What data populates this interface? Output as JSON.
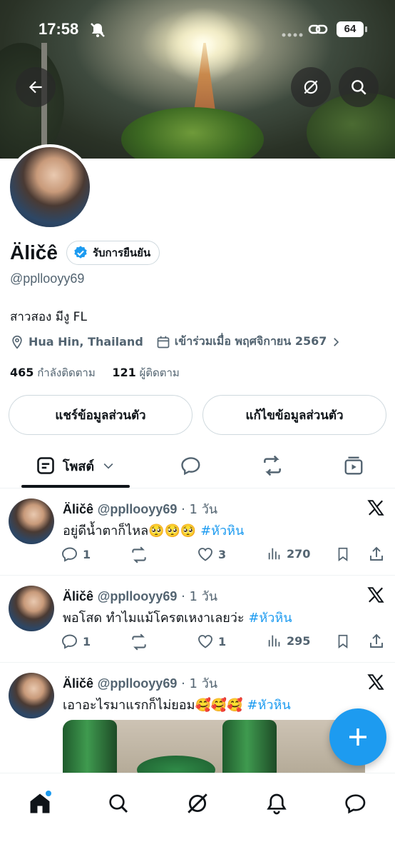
{
  "status_bar": {
    "time": "17:58",
    "battery": "64"
  },
  "profile": {
    "name": "Äličê",
    "verify_label": "รับการยืนยัน",
    "handle": "@ppllooyy69",
    "bio": "สาวสอง มีงู FL",
    "location": "Hua Hin, Thailand",
    "joined": "เข้าร่วมเมื่อ พฤศจิกายน 2567",
    "following_count": "465",
    "following_label": "กำลังติดตาม",
    "followers_count": "121",
    "followers_label": "ผู้ติดตาม",
    "share_button": "แชร์ข้อมูลส่วนตัว",
    "edit_button": "แก้ไขข้อมูลส่วนตัว"
  },
  "tabs": {
    "posts_label": "โพสต์"
  },
  "posts": [
    {
      "name": "Äličê",
      "handle": "@ppllooyy69",
      "time": "· 1 วัน",
      "text": "อยู่ดีน้ำตาก็ไหล🥺🥺🥺 ",
      "hashtag": "#หัวหิน",
      "replies": "1",
      "retweets": "",
      "likes": "3",
      "views": "270"
    },
    {
      "name": "Äličê",
      "handle": "@ppllooyy69",
      "time": "· 1 วัน",
      "text": "พอโสด ทำไมแม้โครตเหงาเลยว่ะ ",
      "hashtag": "#หัวหิน",
      "replies": "1",
      "retweets": "",
      "likes": "1",
      "views": "295"
    },
    {
      "name": "Äličê",
      "handle": "@ppllooyy69",
      "time": "· 1 วัน",
      "text": "เอาอะไรมาแรกก็ไม่ยอม🥰🥰🥰 ",
      "hashtag": "#หัวหิน"
    }
  ],
  "colors": {
    "accent": "#1d9bf0",
    "text": "#0f1419",
    "secondary": "#536471",
    "border": "#cfd9de"
  },
  "icons": [
    "back-arrow-icon",
    "grok-icon",
    "search-icon",
    "calendar-icon",
    "location-icon",
    "reply-icon",
    "retweet-icon",
    "like-icon",
    "views-icon",
    "bookmark-icon",
    "share-icon",
    "x-logo-icon",
    "home-icon",
    "bell-icon",
    "messages-icon",
    "plus-icon"
  ]
}
